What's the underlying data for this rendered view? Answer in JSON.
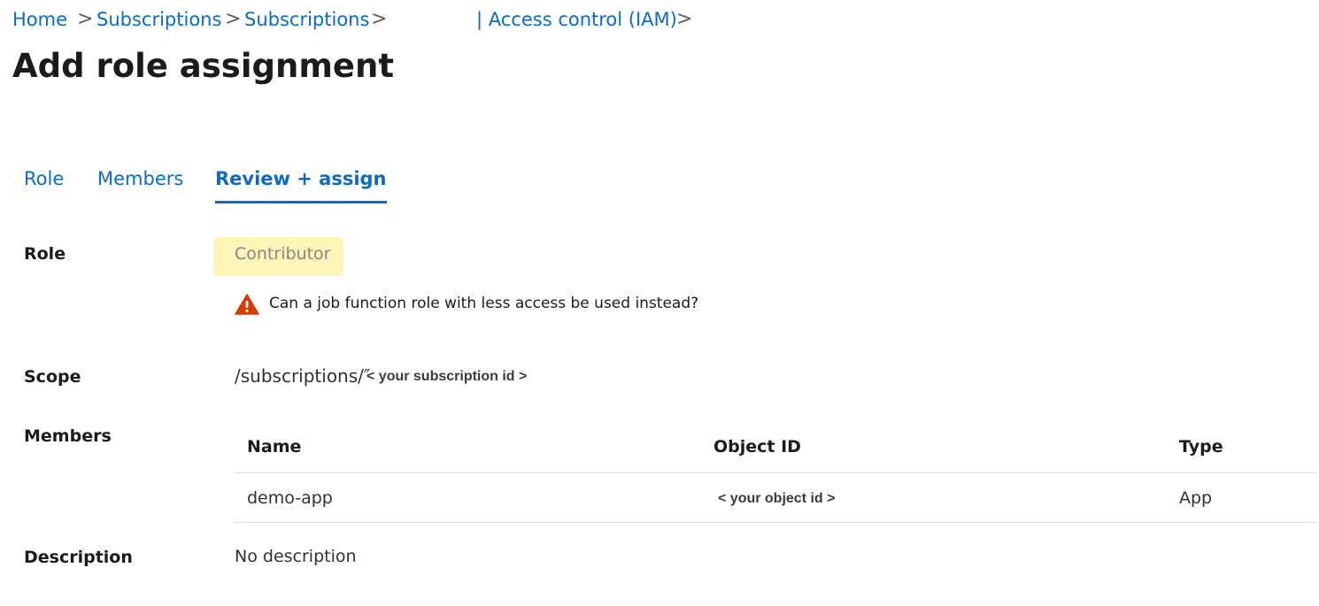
{
  "breadcrumb": {
    "items": [
      "Home",
      "Subscriptions",
      "Subscriptions",
      "| Access control (IAM)"
    ],
    "separator": ">"
  },
  "header": {
    "title": "Add role assignment",
    "more_label": "···"
  },
  "tabs": [
    {
      "label": "Role",
      "active": false
    },
    {
      "label": "Members",
      "active": false
    },
    {
      "label": "Review + assign",
      "active": true
    }
  ],
  "review": {
    "role_label": "Role",
    "role_value": "Contributor",
    "role_highlight_color": "#fdf6b8",
    "warning_icon": "warning-triangle-icon",
    "warning_color": "#d83b01",
    "warning_text": "Can a job function role with less access be used instead?",
    "scope_label": "Scope",
    "scope_value": "/subscriptions/″",
    "scope_placeholder": "< your subscription id >",
    "members_label": "Members",
    "members_table": {
      "columns": [
        "Name",
        "Object ID",
        "Type"
      ],
      "rows": [
        {
          "name": "demo-app",
          "object_id": "< your object id >",
          "type": "App"
        }
      ]
    },
    "description_label": "Description",
    "description_value": "No description"
  },
  "colors": {
    "link": "#0f6cbd",
    "text": "#1b1b1b",
    "divider": "#e1dfdd"
  }
}
